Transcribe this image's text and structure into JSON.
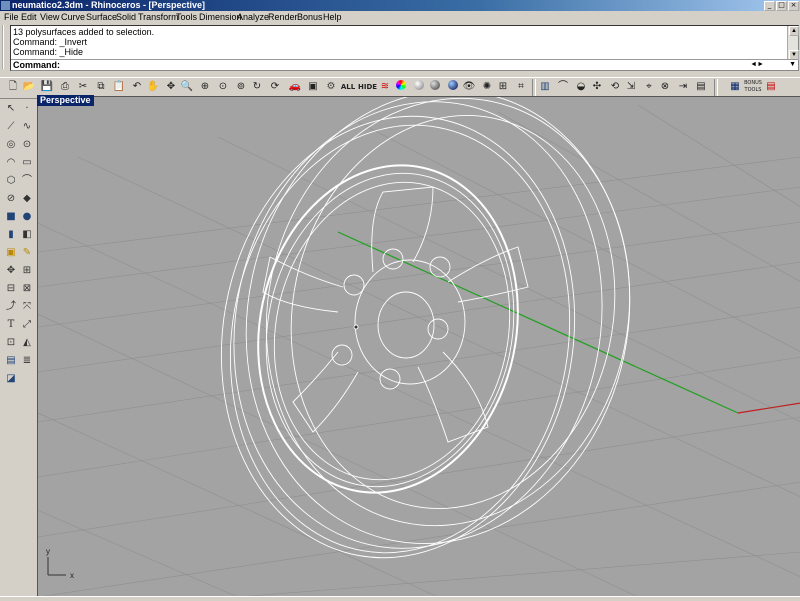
{
  "titlebar": {
    "title": "neumatico2.3dm - Rhinoceros - [Perspective]",
    "buttons": [
      "_",
      "□",
      "×"
    ]
  },
  "menu": [
    "File",
    "Edit",
    "View",
    "Curve",
    "Surface",
    "Solid",
    "Transform",
    "Tools",
    "Dimension",
    "Analyze",
    "Render",
    "Bonus",
    "Help"
  ],
  "command_history": [
    "13 polysurfaces added to selection.",
    "Command: _Invert",
    "Command: _Hide"
  ],
  "command_prompt": "Command:",
  "toolbar_icons": [
    "new-icon",
    "open-icon",
    "save-icon",
    "print-icon",
    "cut-icon",
    "copy-icon",
    "paste-icon",
    "undo-icon",
    "redo-icon",
    "pan-icon",
    "zoom-icon",
    "zoom-window-icon",
    "zoom-extents-icon",
    "zoom-selected-icon",
    "rotate-view-icon",
    "set-view-icon",
    "camera-icon",
    "car-icon",
    "box-icon",
    "show-all-label",
    "hide-label",
    "color-wheel-icon",
    "layers-icon",
    "render-sphere-icon",
    "shaded-icon",
    "blue-sphere-icon",
    "eye-icon",
    "grid-icon",
    "snap-icon",
    "sep",
    "osnap-icon",
    "curve-icon",
    "surface-icon",
    "point-icon",
    "gumball-icon",
    "rotate-icon",
    "target-icon",
    "mesh-icon",
    "export-icon",
    "sep",
    "options-icon",
    "bonus-icon",
    "tools-icon"
  ],
  "toolbar_texts": {
    "all": "ALL",
    "hide": "HIDE",
    "bonus": "BONUS",
    "tools": "TOOLS"
  },
  "viewport": {
    "label": "Perspective",
    "axis_x": "x",
    "axis_y": "y"
  },
  "colors": {
    "grid_bg": "#a3a3a3",
    "grid_line": "#8f8f8f",
    "axis_x": "#c02020",
    "axis_y": "#20a020",
    "wire": "#ffffff",
    "title_blue": "#0a246a"
  }
}
